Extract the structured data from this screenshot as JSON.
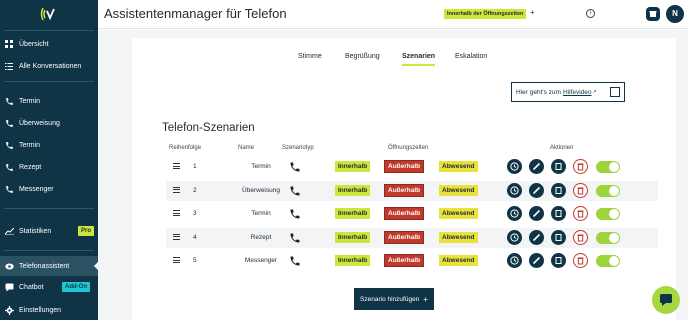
{
  "app": {
    "title": "Assistentenmanager für Telefon",
    "hours_chip": "Innerhalb der Öffnungszeiten",
    "avatar_initial": "N"
  },
  "sidebar": {
    "items": [
      {
        "label": "Übersicht",
        "icon": "grid-icon"
      },
      {
        "label": "Alle Konversationen",
        "icon": "list-icon"
      },
      {
        "label": "Termin",
        "icon": "phone-icon"
      },
      {
        "label": "Überweisung",
        "icon": "phone-icon"
      },
      {
        "label": "Termin",
        "icon": "phone-icon"
      },
      {
        "label": "Rezept",
        "icon": "phone-icon"
      },
      {
        "label": "Messenger",
        "icon": "phone-icon"
      },
      {
        "label": "Statistiken",
        "icon": "chart-icon",
        "badge": "Pro"
      },
      {
        "label": "Telefonassistent",
        "icon": "eye-icon",
        "active": true
      },
      {
        "label": "Chatbot",
        "icon": "chat-icon",
        "badge": "Add-On"
      },
      {
        "label": "Einstellungen",
        "icon": "gear-icon"
      }
    ]
  },
  "tabs": [
    {
      "label": "Stimme"
    },
    {
      "label": "Begrüßung"
    },
    {
      "label": "Szenarien",
      "active": true
    },
    {
      "label": "Eskalation"
    }
  ],
  "help": {
    "prefix": "Hier geht's zum",
    "link": "Hilfevideo"
  },
  "section_title": "Telefon-Szenarien",
  "table": {
    "headers": {
      "order": "Reihenfolge",
      "name": "Name",
      "type": "Szenariotyp",
      "hours": "Öffnungszeiten",
      "actions": "Aktionen"
    },
    "chips": {
      "inside": "Innerhalb",
      "outside": "Außerhalb",
      "absent": "Abwesend"
    },
    "rows": [
      {
        "order": "1",
        "name": "Termin"
      },
      {
        "order": "2",
        "name": "Überweisung"
      },
      {
        "order": "3",
        "name": "Termin"
      },
      {
        "order": "4",
        "name": "Rezept"
      },
      {
        "order": "5",
        "name": "Messenger"
      }
    ]
  },
  "add_button": "Szenario hinzufügen",
  "colors": {
    "navy": "#0f3446",
    "lime": "#cde63a",
    "red": "#c0392b",
    "yellow": "#e8e23a",
    "toggle": "#9ed43b"
  }
}
